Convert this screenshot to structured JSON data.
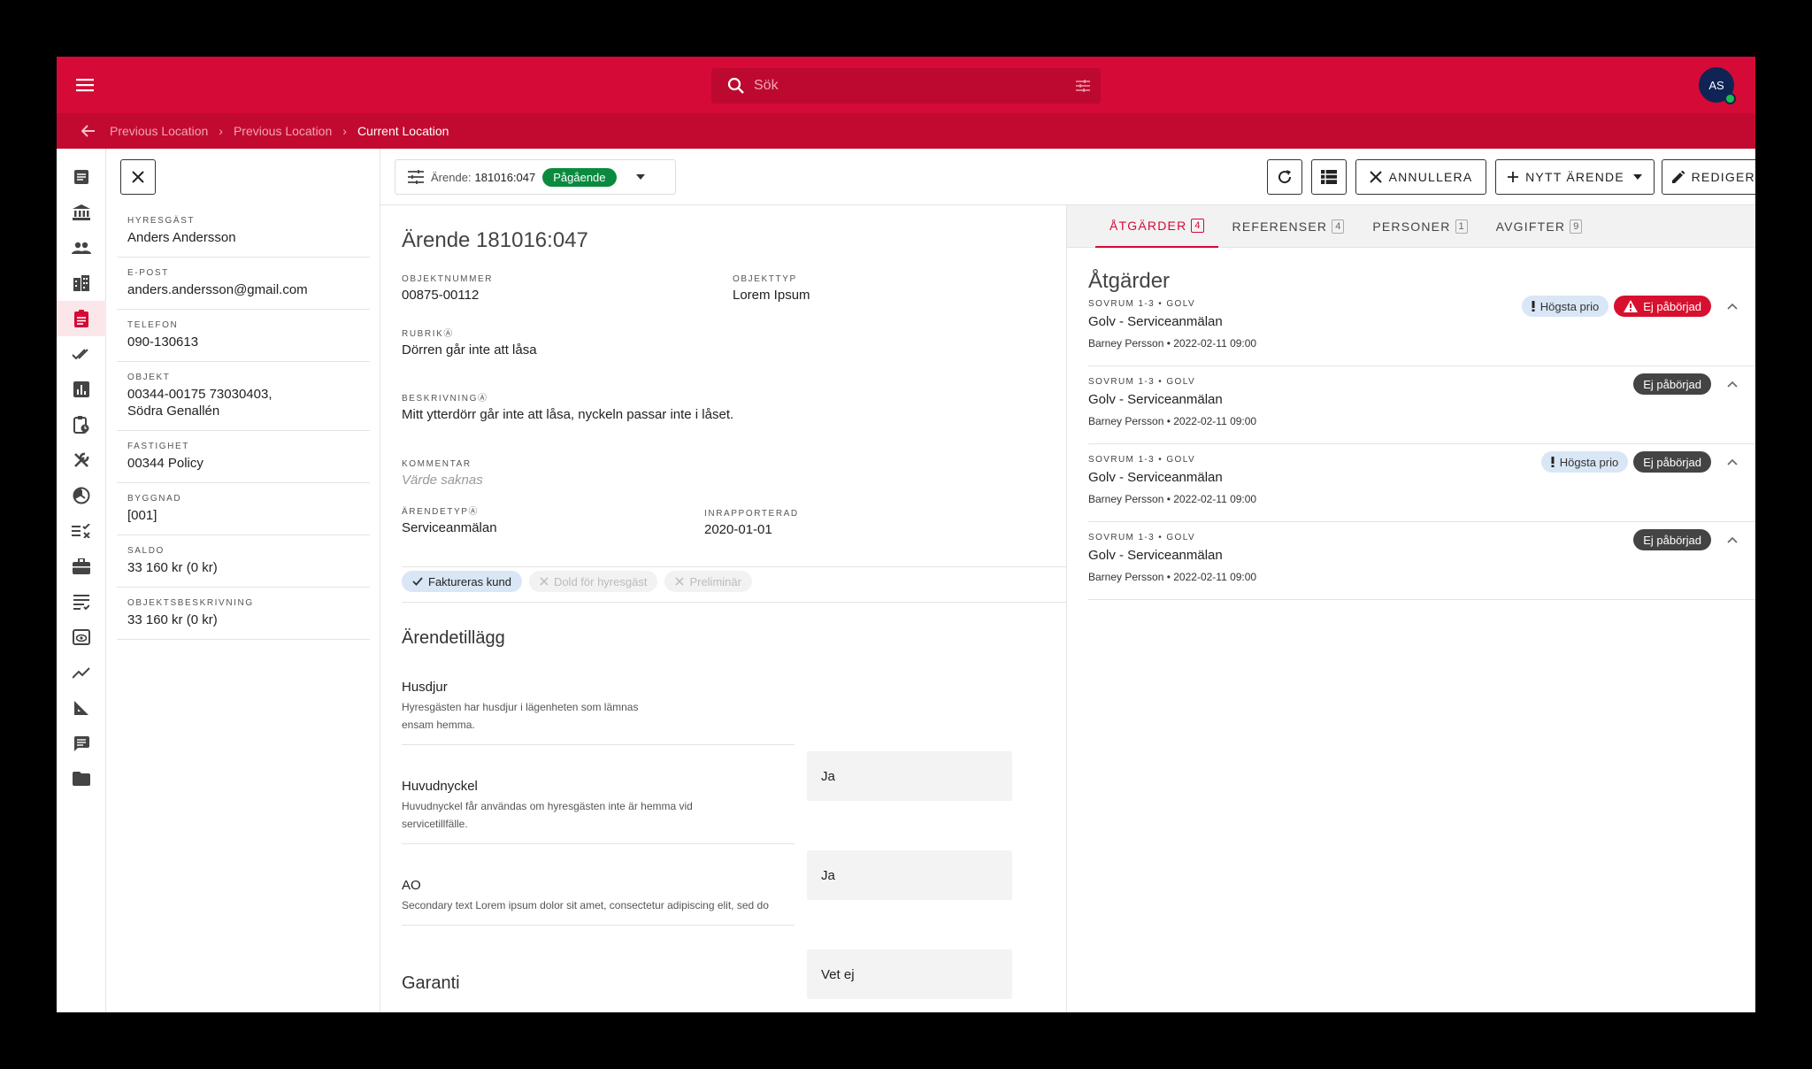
{
  "search": {
    "placeholder": "Sök"
  },
  "user": {
    "initials": "AS"
  },
  "breadcrumb": {
    "items": [
      "Previous Location",
      "Previous Location"
    ],
    "current": "Current Location"
  },
  "info": [
    {
      "label": "HYRESGÄST",
      "value": "Anders Andersson"
    },
    {
      "label": "E-POST",
      "value": "anders.andersson@gmail.com"
    },
    {
      "label": "TELEFON",
      "value": "090-130613"
    },
    {
      "label": "OBJEKT",
      "value": "00344-00175 73030403,",
      "value2": "Södra Genallén"
    },
    {
      "label": "FASTIGHET",
      "value": "00344 Policy"
    },
    {
      "label": "BYGGNAD",
      "value": "[001]"
    },
    {
      "label": "SALDO",
      "value": "33 160 kr (0 kr)"
    },
    {
      "label": "OBJEKTSBESKRIVNING",
      "value": "33 160 kr (0 kr)"
    }
  ],
  "toolbar": {
    "case_prefix": "Ärende:",
    "case_number": "181016:047",
    "case_status": "Pågående",
    "cancel_label": "ANNULLERA",
    "new_label": "NYTT ÄRENDE",
    "edit_label": "REDIGERA"
  },
  "case": {
    "title": "Ärende 181016:047",
    "objektnummer_label": "OBJEKTNUMMER",
    "objektnummer": "00875-00112",
    "objekttyp_label": "OBJEKTTYP",
    "objekttyp": "Lorem Ipsum",
    "rubrik_label": "RUBRIK",
    "rubrik": "Dörren går inte att låsa",
    "beskrivning_label": "BESKRIVNING",
    "beskrivning": "Mitt ytterdörr går inte att låsa, nyckeln passar inte i låset.",
    "kommentar_label": "KOMMENTAR",
    "kommentar": "Värde saknas",
    "arendetyp_label": "ÄRENDETYP",
    "arendetyp": "Serviceanmälan",
    "inrapporterad_label": "INRAPPORTERAD",
    "inrapporterad": "2020-01-01",
    "required_marker": "Ⓐ"
  },
  "chips": [
    {
      "label": "Faktureras kund",
      "on": true
    },
    {
      "label": "Dold för hyresgäst",
      "on": false
    },
    {
      "label": "Preliminär",
      "on": false
    }
  ],
  "addons": {
    "title": "Ärendetillägg",
    "items": [
      {
        "title": "Husdjur",
        "desc": "Hyresgästen har husdjur i lägenheten som lämnas ensam hemma.",
        "value": "Ja"
      },
      {
        "title": "Huvudnyckel",
        "desc": "Huvudnyckel får användas om hyresgästen inte är hemma vid servicetillfälle.",
        "value": "Ja"
      },
      {
        "title": "AO",
        "desc": "Secondary text Lorem ipsum dolor sit amet, consectetur adipiscing elit, sed do",
        "value": "Vet ej"
      }
    ]
  },
  "garanti": {
    "title": "Garanti"
  },
  "tabs": [
    {
      "label": "ÅTGÄRDER",
      "count": "4"
    },
    {
      "label": "REFERENSER",
      "count": "4"
    },
    {
      "label": "PERSONER",
      "count": "1"
    },
    {
      "label": "AVGIFTER",
      "count": "9"
    }
  ],
  "actions": {
    "title": "Åtgärder",
    "items": [
      {
        "sub": "SOVRUM 1-3 • GOLV",
        "title": "Golv - Serviceanmälan",
        "meta": "Barney Persson  • 2022-02-11 09:00",
        "prio": "Högsta prio",
        "status": "Ej påbörjad",
        "status_kind": "red"
      },
      {
        "sub": "SOVRUM 1-3 • GOLV",
        "title": "Golv - Serviceanmälan",
        "meta": "Barney Persson  • 2022-02-11 09:00",
        "prio": "",
        "status": "Ej påbörjad",
        "status_kind": "grey"
      },
      {
        "sub": "SOVRUM 1-3 • GOLV",
        "title": "Golv - Serviceanmälan",
        "meta": "Barney Persson  • 2022-02-11 09:00",
        "prio": "Högsta prio",
        "status": "Ej påbörjad",
        "status_kind": "grey"
      },
      {
        "sub": "SOVRUM 1-3 • GOLV",
        "title": "Golv - Serviceanmälan",
        "meta": "Barney Persson  • 2022-02-11 09:00",
        "prio": "",
        "status": "Ej påbörjad",
        "status_kind": "grey"
      }
    ]
  },
  "colors": {
    "brand": "#d50a36",
    "success": "#0b8a3f",
    "danger": "#d8102f"
  }
}
